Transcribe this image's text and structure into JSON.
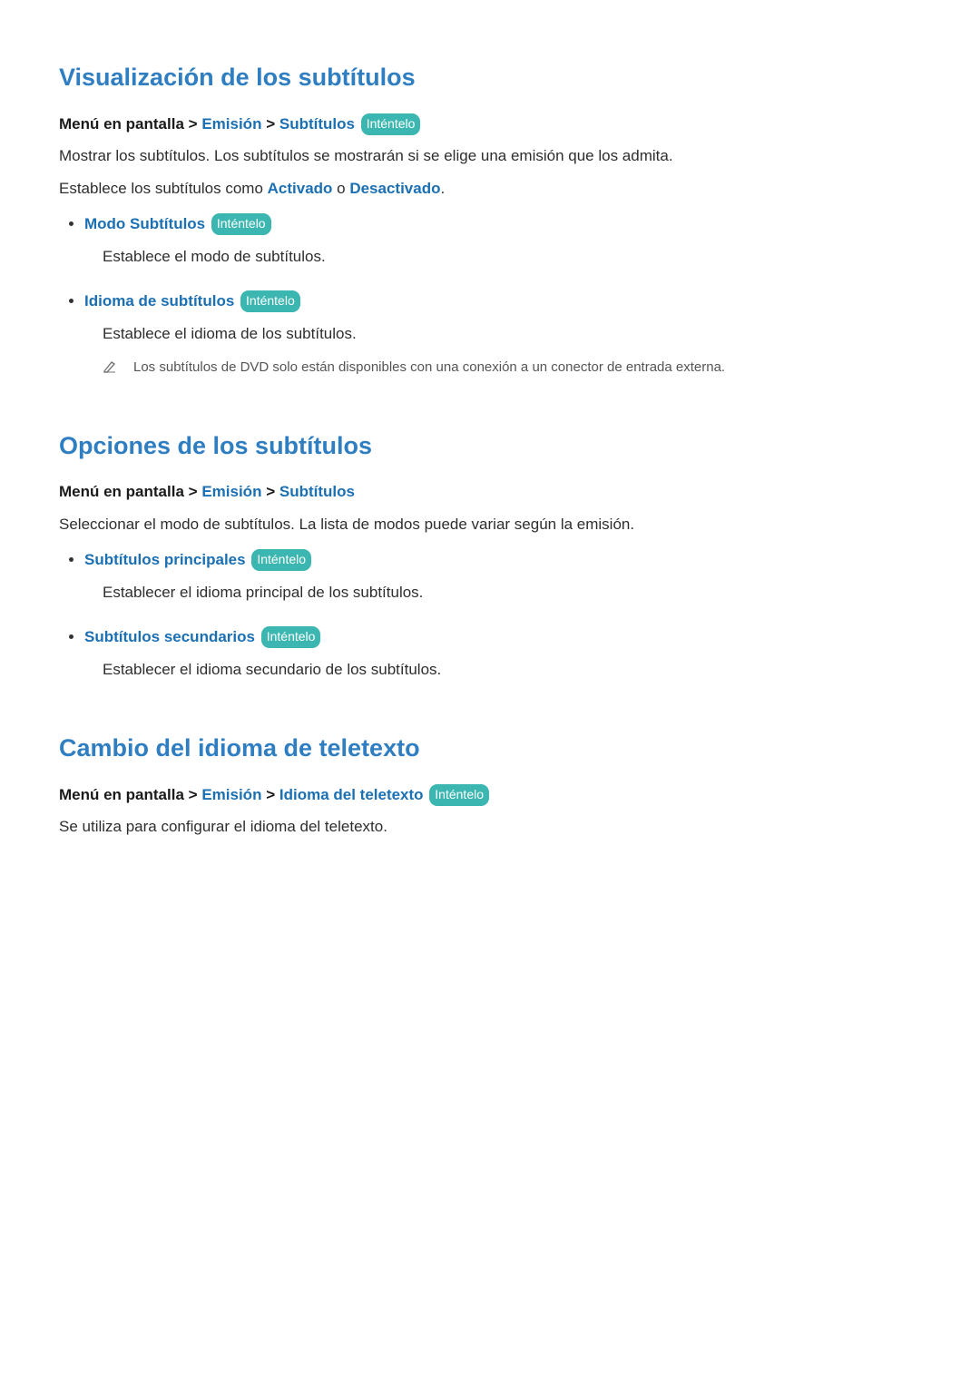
{
  "sections": [
    {
      "heading": "Visualización de los subtítulos",
      "breadcrumb": {
        "root": "Menú en pantalla",
        "path": [
          "Emisión",
          "Subtítulos"
        ],
        "try": "Inténtelo"
      },
      "paragraphs": [
        {
          "text": "Mostrar los subtítulos. Los subtítulos se mostrarán si se elige una emisión que los admita."
        },
        {
          "prefix": "Establece los subtítulos como ",
          "accent1": "Activado",
          "mid": " o ",
          "accent2": "Desactivado",
          "suffix": "."
        }
      ],
      "options": [
        {
          "title": "Modo Subtítulos",
          "try": "Inténtelo",
          "desc": "Establece el modo de subtítulos."
        },
        {
          "title": "Idioma de subtítulos",
          "try": "Inténtelo",
          "desc": "Establece el idioma de los subtítulos.",
          "note": "Los subtítulos de DVD solo están disponibles con una conexión a un conector de entrada externa."
        }
      ]
    },
    {
      "heading": "Opciones de los subtítulos",
      "breadcrumb": {
        "root": "Menú en pantalla",
        "path": [
          "Emisión",
          "Subtítulos"
        ]
      },
      "paragraphs": [
        {
          "text": "Seleccionar el modo de subtítulos. La lista de modos puede variar según la emisión."
        }
      ],
      "options": [
        {
          "title": "Subtítulos principales",
          "try": "Inténtelo",
          "desc": "Establecer el idioma principal de los subtítulos."
        },
        {
          "title": "Subtítulos secundarios",
          "try": "Inténtelo",
          "desc": "Establecer el idioma secundario de los subtítulos."
        }
      ]
    },
    {
      "heading": "Cambio del idioma de teletexto",
      "breadcrumb": {
        "root": "Menú en pantalla",
        "path": [
          "Emisión",
          "Idioma del teletexto"
        ],
        "try": "Inténtelo"
      },
      "paragraphs": [
        {
          "text": "Se utiliza para configurar el idioma del teletexto."
        }
      ],
      "options": []
    }
  ],
  "sep": ">"
}
